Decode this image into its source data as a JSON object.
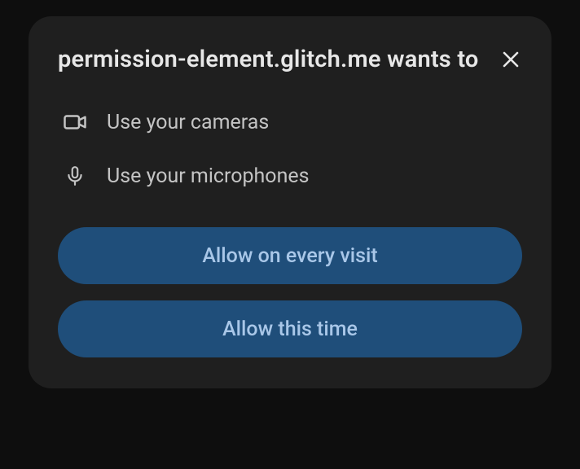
{
  "dialog": {
    "origin": "permission-element.glitch.me",
    "title_suffix": "wants to",
    "permissions": [
      {
        "icon": "camera-icon",
        "label": "Use your cameras"
      },
      {
        "icon": "microphone-icon",
        "label": "Use your microphones"
      }
    ],
    "actions": {
      "primary": "Allow on every visit",
      "secondary": "Allow this time"
    }
  }
}
